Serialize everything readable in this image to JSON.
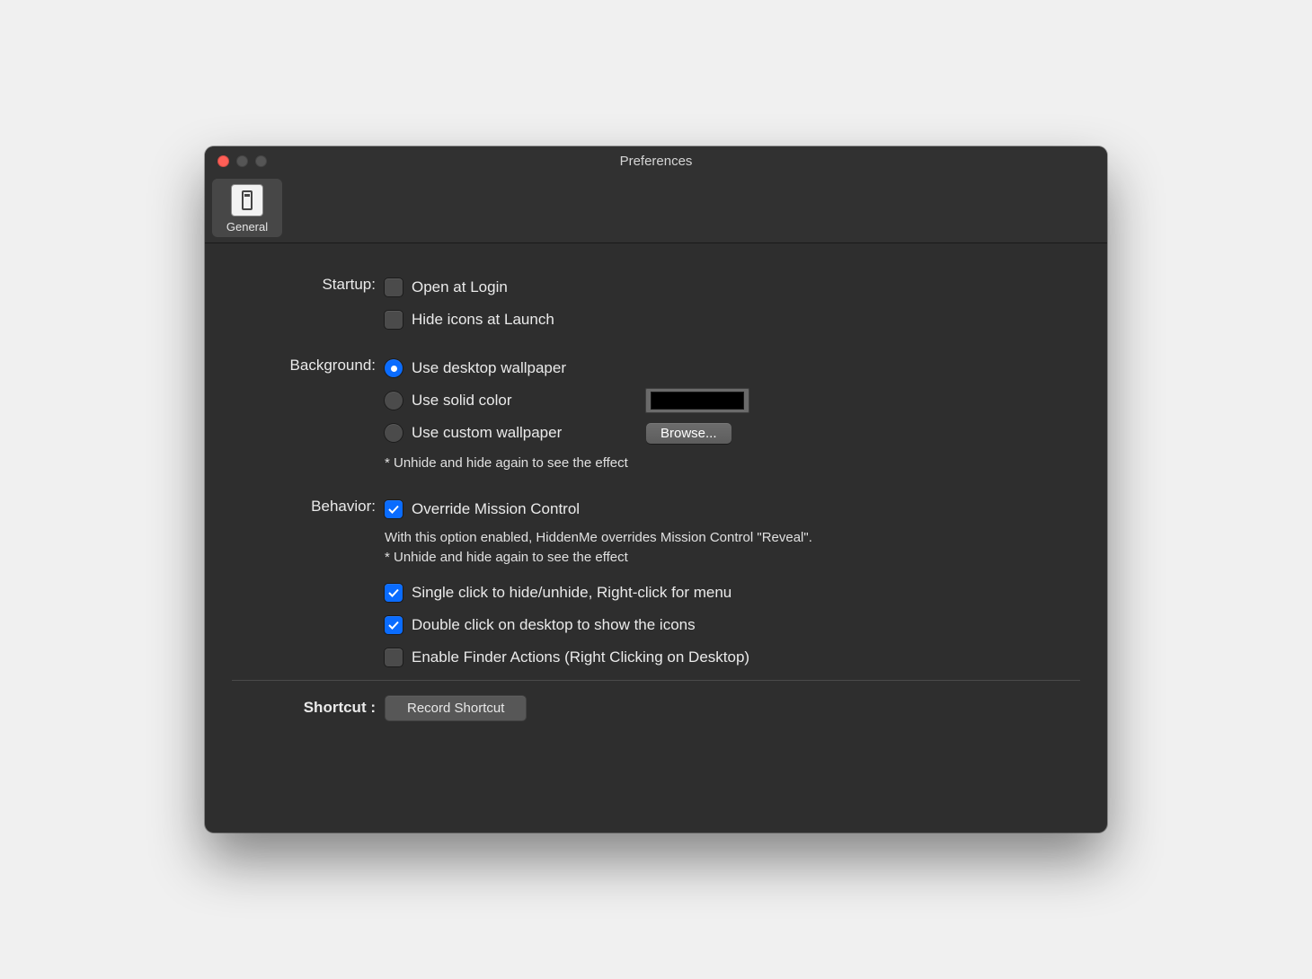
{
  "title": "Preferences",
  "tab": {
    "label": "General"
  },
  "startup": {
    "label": "Startup:",
    "openAtLogin": "Open at Login",
    "hideAtLaunch": "Hide icons at Launch"
  },
  "background": {
    "label": "Background:",
    "useDesktop": "Use desktop wallpaper",
    "useSolid": "Use solid color",
    "useCustom": "Use custom wallpaper",
    "browse": "Browse...",
    "note": "* Unhide and hide again to see the effect",
    "solidColor": "#000000"
  },
  "behavior": {
    "label": "Behavior:",
    "override": "Override Mission Control",
    "overrideNote1": "With this option enabled, HiddenMe overrides Mission Control \"Reveal\".",
    "overrideNote2": "* Unhide and hide again to see the effect",
    "singleClick": "Single click to hide/unhide, Right-click for menu",
    "doubleClick": "Double click on desktop to show the icons",
    "finderActions": "Enable Finder Actions (Right Clicking on Desktop)"
  },
  "shortcut": {
    "label": "Shortcut :",
    "record": "Record Shortcut"
  }
}
